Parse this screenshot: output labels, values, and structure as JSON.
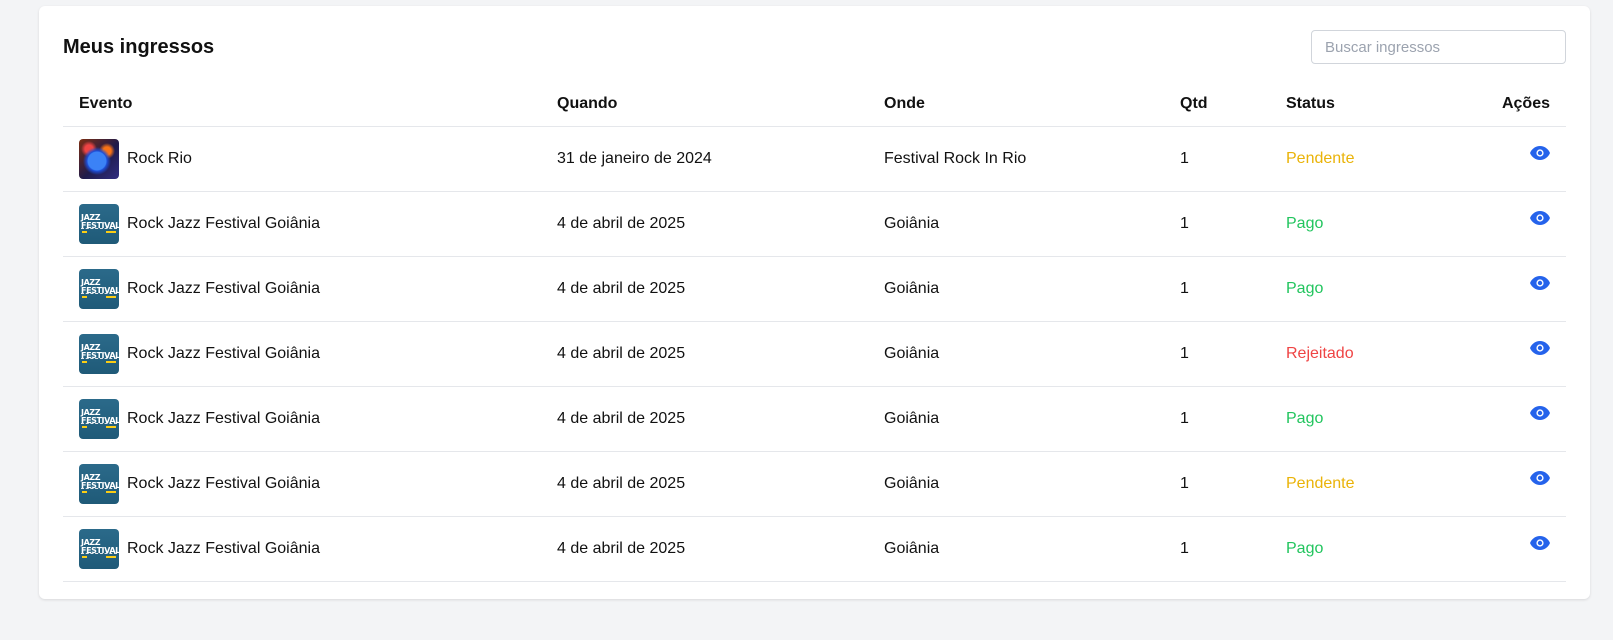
{
  "header": {
    "title": "Meus ingressos",
    "search_placeholder": "Buscar ingressos",
    "search_value": ""
  },
  "table": {
    "columns": [
      "Evento",
      "Quando",
      "Onde",
      "Qtd",
      "Status",
      "Ações"
    ],
    "rows": [
      {
        "thumb": "rock",
        "event": "Rock Rio",
        "when": "31 de janeiro de 2024",
        "where": "Festival Rock In Rio",
        "qty": "1",
        "status": "Pendente",
        "status_color": "#eab308"
      },
      {
        "thumb": "jazz",
        "event": "Rock Jazz Festival Goiânia",
        "when": "4 de abril de 2025",
        "where": "Goiânia",
        "qty": "1",
        "status": "Pago",
        "status_color": "#22c55e"
      },
      {
        "thumb": "jazz",
        "event": "Rock Jazz Festival Goiânia",
        "when": "4 de abril de 2025",
        "where": "Goiânia",
        "qty": "1",
        "status": "Pago",
        "status_color": "#22c55e"
      },
      {
        "thumb": "jazz",
        "event": "Rock Jazz Festival Goiânia",
        "when": "4 de abril de 2025",
        "where": "Goiânia",
        "qty": "1",
        "status": "Rejeitado",
        "status_color": "#ef4444"
      },
      {
        "thumb": "jazz",
        "event": "Rock Jazz Festival Goiânia",
        "when": "4 de abril de 2025",
        "where": "Goiânia",
        "qty": "1",
        "status": "Pago",
        "status_color": "#22c55e"
      },
      {
        "thumb": "jazz",
        "event": "Rock Jazz Festival Goiânia",
        "when": "4 de abril de 2025",
        "where": "Goiânia",
        "qty": "1",
        "status": "Pendente",
        "status_color": "#eab308"
      },
      {
        "thumb": "jazz",
        "event": "Rock Jazz Festival Goiânia",
        "when": "4 de abril de 2025",
        "where": "Goiânia",
        "qty": "1",
        "status": "Pago",
        "status_color": "#22c55e"
      }
    ],
    "action_icon": "eye-icon",
    "action_color": "#2563eb"
  },
  "thumb_text": {
    "jazz": "JAZZ FESTIVAL"
  }
}
